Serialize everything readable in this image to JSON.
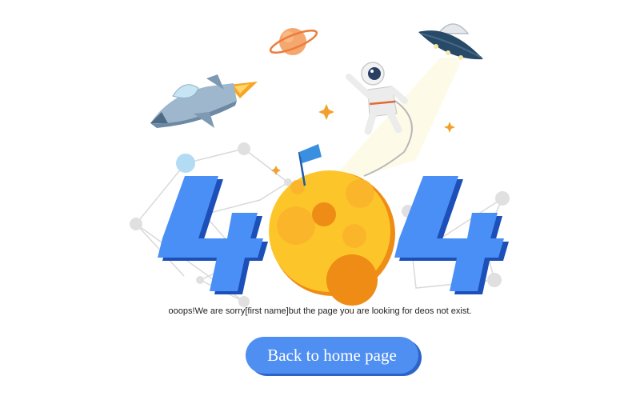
{
  "error": {
    "code_digits": [
      "4",
      "4"
    ],
    "message": "ooops!We are sorry[first name]but the page you are looking for deos not exist."
  },
  "actions": {
    "home_label": "Back to home page"
  },
  "colors": {
    "accent": "#4f8ff1",
    "digit": "#4a8ff5",
    "digit_shadow": "#1d4fb8",
    "moon": "#fcc62b",
    "moon_crater": "#ee8c15"
  },
  "illustration": {
    "icons": [
      "rocket-icon",
      "planet-icon",
      "ufo-icon",
      "astronaut-icon",
      "moon-icon",
      "flag-icon",
      "sparkle-icon",
      "constellation-icon"
    ]
  }
}
